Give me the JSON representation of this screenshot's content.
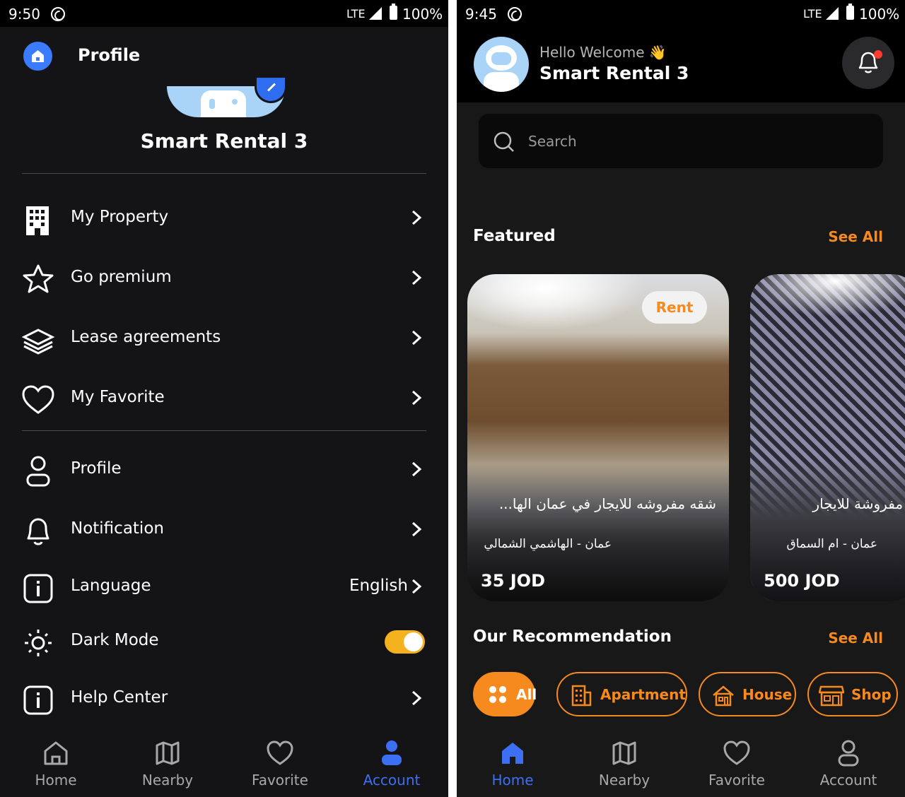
{
  "left": {
    "status": {
      "time": "9:50",
      "network": "LTE",
      "battery": "100%"
    },
    "header_title": "Profile",
    "user_name": "Smart Rental 3",
    "menu": [
      {
        "label": "My Property",
        "icon": "building-icon"
      },
      {
        "label": "Go premium",
        "icon": "star-icon"
      },
      {
        "label": "Lease agreements",
        "icon": "layers-icon"
      },
      {
        "label": "My Favorite",
        "icon": "heart-icon"
      },
      {
        "label": "Profile",
        "icon": "user-icon"
      },
      {
        "label": "Notification",
        "icon": "bell-icon"
      },
      {
        "label": "Language",
        "icon": "info-icon",
        "value": "English"
      },
      {
        "label": "Dark Mode",
        "icon": "sun-icon",
        "toggle": true
      },
      {
        "label": "Help Center",
        "icon": "info-icon"
      }
    ],
    "nav": [
      {
        "label": "Home",
        "icon": "home-icon"
      },
      {
        "label": "Nearby",
        "icon": "map-icon"
      },
      {
        "label": "Favorite",
        "icon": "heart-icon"
      },
      {
        "label": "Account",
        "icon": "user-icon",
        "active": true
      }
    ]
  },
  "right": {
    "status": {
      "time": "9:45",
      "network": "LTE",
      "battery": "100%"
    },
    "greeting": "Hello Welcome",
    "greeting_emoji": "👋",
    "user_name": "Smart Rental 3",
    "search_placeholder": "Search",
    "featured_title": "Featured",
    "see_all": "See All",
    "featured": [
      {
        "tag": "Rent",
        "title": "شقه مفروشه للايجار في عمان الها...",
        "location": "عمان - الهاشمي الشمالي",
        "price": "35 JOD"
      },
      {
        "title": "شقة مفروشة للايجار",
        "location": "عمان - ام السماق",
        "price": "500 JOD"
      }
    ],
    "recommendation_title": "Our Recommendation",
    "chips": [
      {
        "label": "All",
        "icon": "grid-icon",
        "selected": true
      },
      {
        "label": "Apartment",
        "icon": "apartment-icon"
      },
      {
        "label": "House",
        "icon": "house-icon"
      },
      {
        "label": "Shop",
        "icon": "shop-icon"
      }
    ],
    "nav": [
      {
        "label": "Home",
        "icon": "home-icon",
        "active": true
      },
      {
        "label": "Nearby",
        "icon": "map-icon"
      },
      {
        "label": "Favorite",
        "icon": "heart-icon"
      },
      {
        "label": "Account",
        "icon": "user-icon"
      }
    ]
  },
  "colors": {
    "accent_orange": "#f68a1f",
    "accent_blue": "#3d6ff5",
    "toggle_on": "#f5b21f",
    "background": "#141416"
  }
}
